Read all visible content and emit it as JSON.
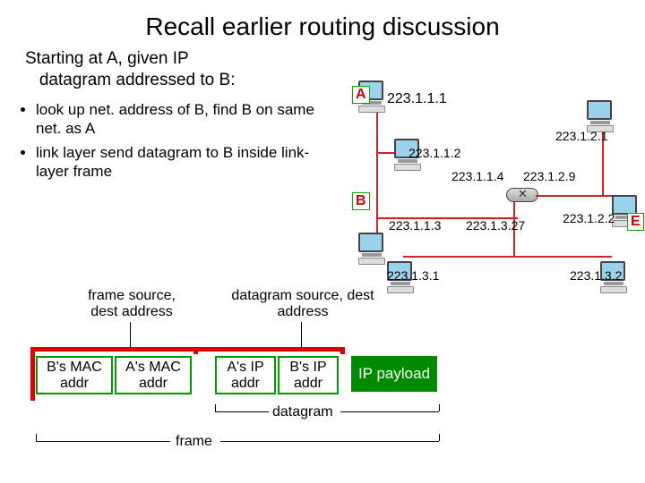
{
  "title": "Recall earlier routing discussion",
  "intro_l1": "Starting at A, given IP",
  "intro_l2": "datagram addressed to B:",
  "bullets": [
    "look up net. address of B, find B on same net. as A",
    "link layer send datagram to B inside link-layer frame"
  ],
  "nodes": {
    "A": "A",
    "B": "B",
    "E": "E"
  },
  "ips": {
    "a": "223.1.1.1",
    "a2": "223.1.1.2",
    "b": "223.1.1.3",
    "r1": "223.1.1.4",
    "r2": "223.1.2.9",
    "e_top": "223.1.2.1",
    "e": "223.1.2.2",
    "r3": "223.1.3.27",
    "d1": "223.1.3.1",
    "d2": "223.1.3.2"
  },
  "upper": {
    "frame_src": "frame source, dest address",
    "dgram_src": "datagram source, dest address"
  },
  "pkt": {
    "bmac": "B's MAC addr",
    "amac": "A's MAC addr",
    "aip": "A's IP addr",
    "bip": "B's IP addr",
    "payload": "IP payload"
  },
  "span": {
    "datagram": "datagram",
    "frame": "frame"
  }
}
